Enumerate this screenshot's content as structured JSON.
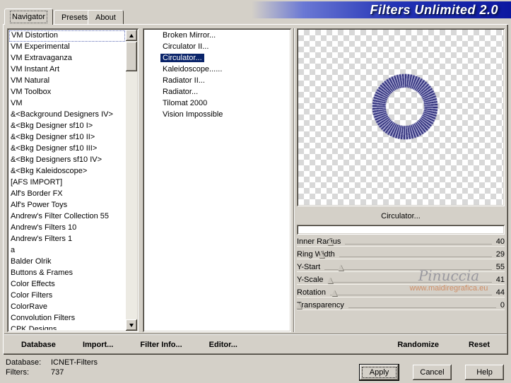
{
  "banner": {
    "title": "Filters Unlimited 2.0"
  },
  "tabs": {
    "items": [
      {
        "label": "Navigator"
      },
      {
        "label": "Presets"
      },
      {
        "label": "About"
      }
    ],
    "active_index": 0
  },
  "category_list": {
    "focused_index": 0,
    "items": [
      "VM Distortion",
      "VM Experimental",
      "VM Extravaganza",
      "VM Instant Art",
      "VM Natural",
      "VM Toolbox",
      "VM",
      "&<Background Designers IV>",
      "&<Bkg Designer sf10 I>",
      "&<Bkg Designer sf10 II>",
      "&<Bkg Designer sf10 III>",
      "&<Bkg Designers sf10 IV>",
      "&<Bkg Kaleidoscope>",
      "[AFS IMPORT]",
      "Alf's Border FX",
      "Alf's Power Toys",
      "Andrew's Filter Collection 55",
      "Andrew's Filters 10",
      "Andrew's Filters 1",
      "a",
      "Balder Olrik",
      "Buttons & Frames",
      "Color Effects",
      "Color Filters",
      "ColorRave",
      "Convolution Filters",
      "CPK Designs"
    ]
  },
  "filter_list": {
    "selected_index": 2,
    "items": [
      "Broken Mirror...",
      "Circulator II...",
      "Circulator...",
      "Kaleidoscope......",
      "Radiator II...",
      "Radiator...",
      "Tilomat 2000",
      "Vision Impossible"
    ]
  },
  "preview": {
    "caption": "Circulator..."
  },
  "parameters": {
    "rows": [
      {
        "label": "Inner Radius",
        "value": "40",
        "pct": 16
      },
      {
        "label": "Ring Width",
        "value": "29",
        "pct": 12
      },
      {
        "label": "Y-Start",
        "value": "55",
        "pct": 21
      },
      {
        "label": "Y-Scale",
        "value": "41",
        "pct": 16
      },
      {
        "label": "Rotation",
        "value": "44",
        "pct": 18
      },
      {
        "label": "Transparency",
        "value": "0",
        "pct": 1
      }
    ]
  },
  "watermark": {
    "name": "Pinuccia",
    "url": "www.maidiregrafica.eu"
  },
  "panel_actions": {
    "left": [
      "Database",
      "Import...",
      "Filter Info...",
      "Editor..."
    ],
    "right": [
      "Randomize",
      "Reset"
    ]
  },
  "statusbar": {
    "database_label": "Database:",
    "database_value": "ICNET-Filters",
    "filters_label": "Filters:",
    "filters_value": "737"
  },
  "dialog_buttons": [
    "Apply",
    "Cancel",
    "Help"
  ],
  "colors": {
    "face": "#d4d0c8",
    "selection": "#0a246a",
    "banner_blue": "#0c18a0",
    "ring_dark": "#30307c",
    "ring_light": "#9c9cc8",
    "watermark_gray": "#8f8f98",
    "watermark_url": "#cf8e66"
  }
}
